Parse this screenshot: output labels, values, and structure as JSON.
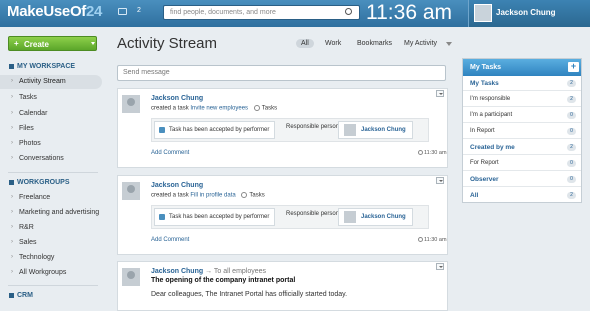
{
  "header": {
    "logo_main": "MakeUseOf",
    "logo_num": "24",
    "notif_count": "2",
    "search_placeholder": "find people, documents, and more",
    "clock": "11:36 am",
    "user_name": "Jackson Chung"
  },
  "sidebar": {
    "create_label": "Create",
    "workspace_head": "MY WORKSPACE",
    "workspace_items": [
      "Activity Stream",
      "Tasks",
      "Calendar",
      "Files",
      "Photos",
      "Conversations"
    ],
    "workgroups_head": "WORKGROUPS",
    "workgroup_items": [
      "Freelance",
      "Marketing and advertising",
      "R&R",
      "Sales",
      "Technology",
      "All Workgroups"
    ],
    "crm_head": "CRM"
  },
  "main": {
    "title": "Activity Stream",
    "tabs": [
      "All",
      "Work",
      "Bookmarks",
      "My Activity"
    ],
    "send_placeholder": "Send message",
    "posts": [
      {
        "author": "Jackson Chung",
        "action_prefix": "created a task",
        "task_link": "Invite new employees",
        "module": "Tasks",
        "status": "Task has been accepted by performer",
        "resp_label": "Responsible person:",
        "resp_name": "Jackson Chung",
        "add_comment": "Add Comment",
        "time": "11:30 am"
      },
      {
        "author": "Jackson Chung",
        "action_prefix": "created a task",
        "task_link": "Fill in profile data",
        "module": "Tasks",
        "status": "Task has been accepted by performer",
        "resp_label": "Responsible person:",
        "resp_name": "Jackson Chung",
        "add_comment": "Add Comment",
        "time": "11:30 am"
      }
    ],
    "announcement": {
      "author": "Jackson Chung",
      "to": "→ To all employees",
      "title": "The opening of the company intranet portal",
      "body": "Dear colleagues, The Intranet Portal has officially started today."
    }
  },
  "tasks_panel": {
    "title": "My Tasks",
    "rows": [
      {
        "label": "My Tasks",
        "count": "2",
        "bold": true
      },
      {
        "label": "I'm responsible",
        "count": "2",
        "bold": false
      },
      {
        "label": "I'm a participant",
        "count": "0",
        "bold": false
      },
      {
        "label": "In Report",
        "count": "0",
        "bold": false
      },
      {
        "label": "Created by me",
        "count": "2",
        "bold": true
      },
      {
        "label": "For Report",
        "count": "0",
        "bold": false
      },
      {
        "label": "Observer",
        "count": "0",
        "bold": true
      },
      {
        "label": "All",
        "count": "2",
        "bold": true
      }
    ]
  }
}
